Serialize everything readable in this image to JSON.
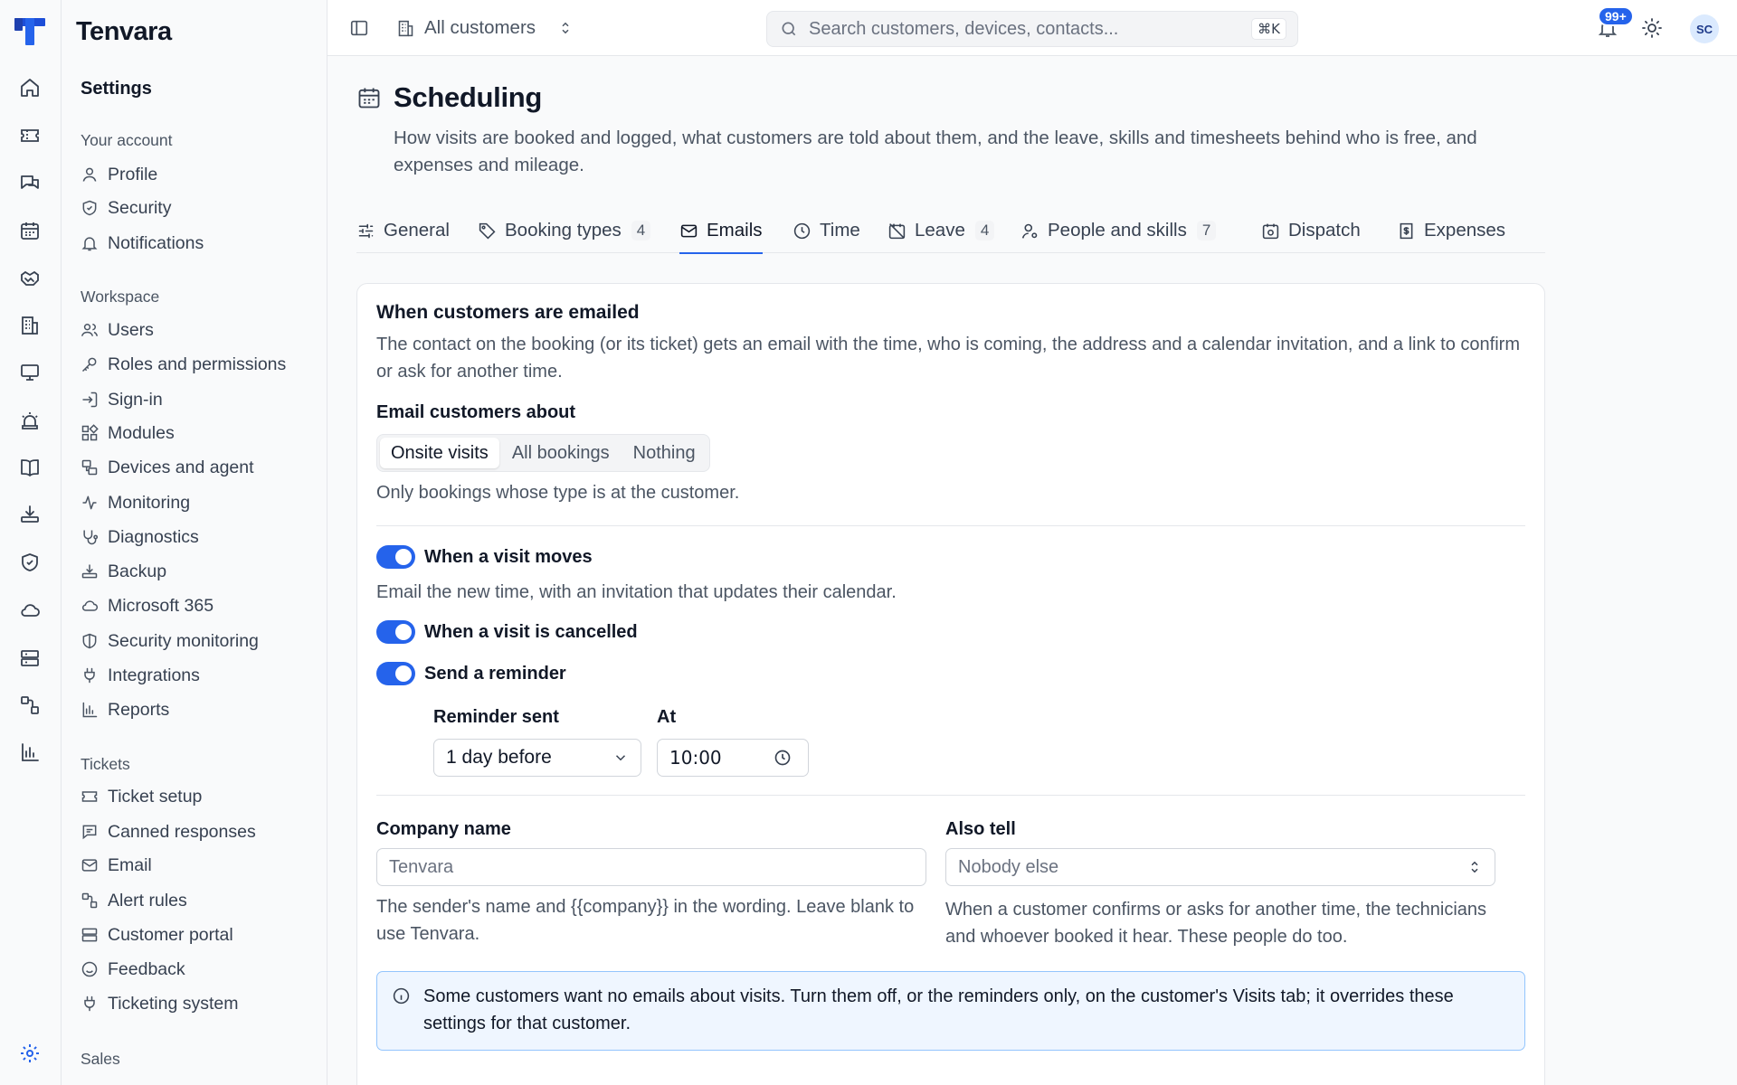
{
  "app": {
    "name": "Tenvara"
  },
  "topbar": {
    "scope": "All customers",
    "search_placeholder": "Search customers, devices, contacts...",
    "search_shortcut": "⌘K",
    "notification_count": "99+",
    "avatar_initials": "SC"
  },
  "rail": {
    "icons": [
      "home-icon",
      "ticket-icon",
      "chat-icon",
      "calendar-icon",
      "handshake-icon",
      "building-icon",
      "monitor-icon",
      "alarm-icon",
      "book-icon",
      "download-icon",
      "shield-icon",
      "cloud-icon",
      "server-icon",
      "workflow-icon",
      "chart-icon",
      "settings-icon"
    ]
  },
  "sidebar": {
    "title": "Settings",
    "groups": [
      {
        "label": "Your account",
        "items": [
          "Profile",
          "Security",
          "Notifications"
        ]
      },
      {
        "label": "Workspace",
        "items": [
          "Users",
          "Roles and permissions",
          "Sign-in",
          "Modules",
          "Devices and agent",
          "Monitoring",
          "Diagnostics",
          "Backup",
          "Microsoft 365",
          "Security monitoring",
          "Integrations",
          "Reports"
        ]
      },
      {
        "label": "Tickets",
        "items": [
          "Ticket setup",
          "Canned responses",
          "Email",
          "Alert rules",
          "Customer portal",
          "Feedback",
          "Ticketing system"
        ]
      },
      {
        "label": "Sales",
        "items": []
      }
    ]
  },
  "page": {
    "title": "Scheduling",
    "description": "How visits are booked and logged, what customers are told about them, and the leave, skills and timesheets behind who is free, and expenses and mileage."
  },
  "tabs": [
    {
      "label": "General",
      "count": ""
    },
    {
      "label": "Booking types",
      "count": "4"
    },
    {
      "label": "Emails",
      "count": ""
    },
    {
      "label": "Time",
      "count": ""
    },
    {
      "label": "Leave",
      "count": "4"
    },
    {
      "label": "People and skills",
      "count": "7"
    },
    {
      "label": "Dispatch",
      "count": ""
    },
    {
      "label": "Expenses",
      "count": ""
    }
  ],
  "active_tab": "Emails",
  "emails": {
    "title": "When customers are emailed",
    "description": "The contact on the booking (or its ticket) gets an email with the time, who is coming, the address and a calendar invitation, and a link to confirm or ask for another time.",
    "about_label": "Email customers about",
    "about_options": [
      "Onsite visits",
      "All bookings",
      "Nothing"
    ],
    "about_selected": "Onsite visits",
    "about_help": "Only bookings whose type is at the customer.",
    "toggle_moves": {
      "label": "When a visit moves",
      "on": true,
      "help": "Email the new time, with an invitation that updates their calendar."
    },
    "toggle_cancelled": {
      "label": "When a visit is cancelled",
      "on": true
    },
    "toggle_reminder": {
      "label": "Send a reminder",
      "on": true
    },
    "reminder_sent_label": "Reminder sent",
    "reminder_sent_value": "1 day before",
    "at_label": "At",
    "at_value": "10:00",
    "company_label": "Company name",
    "company_placeholder": "Tenvara",
    "company_help": "The sender's name and {{company}} in the wording. Leave blank to use Tenvara.",
    "also_tell_label": "Also tell",
    "also_tell_value": "Nobody else",
    "also_tell_help": "When a customer confirms or asks for another time, the technicians and whoever booked it hear. These people do too.",
    "info": "Some customers want no emails about visits. Turn them off, or the reminders only, on the customer's Visits tab; it overrides these settings for that customer."
  },
  "colors": {
    "accent": "#2563eb",
    "info_bg": "#eff6ff",
    "info_border": "#93c5fd"
  }
}
